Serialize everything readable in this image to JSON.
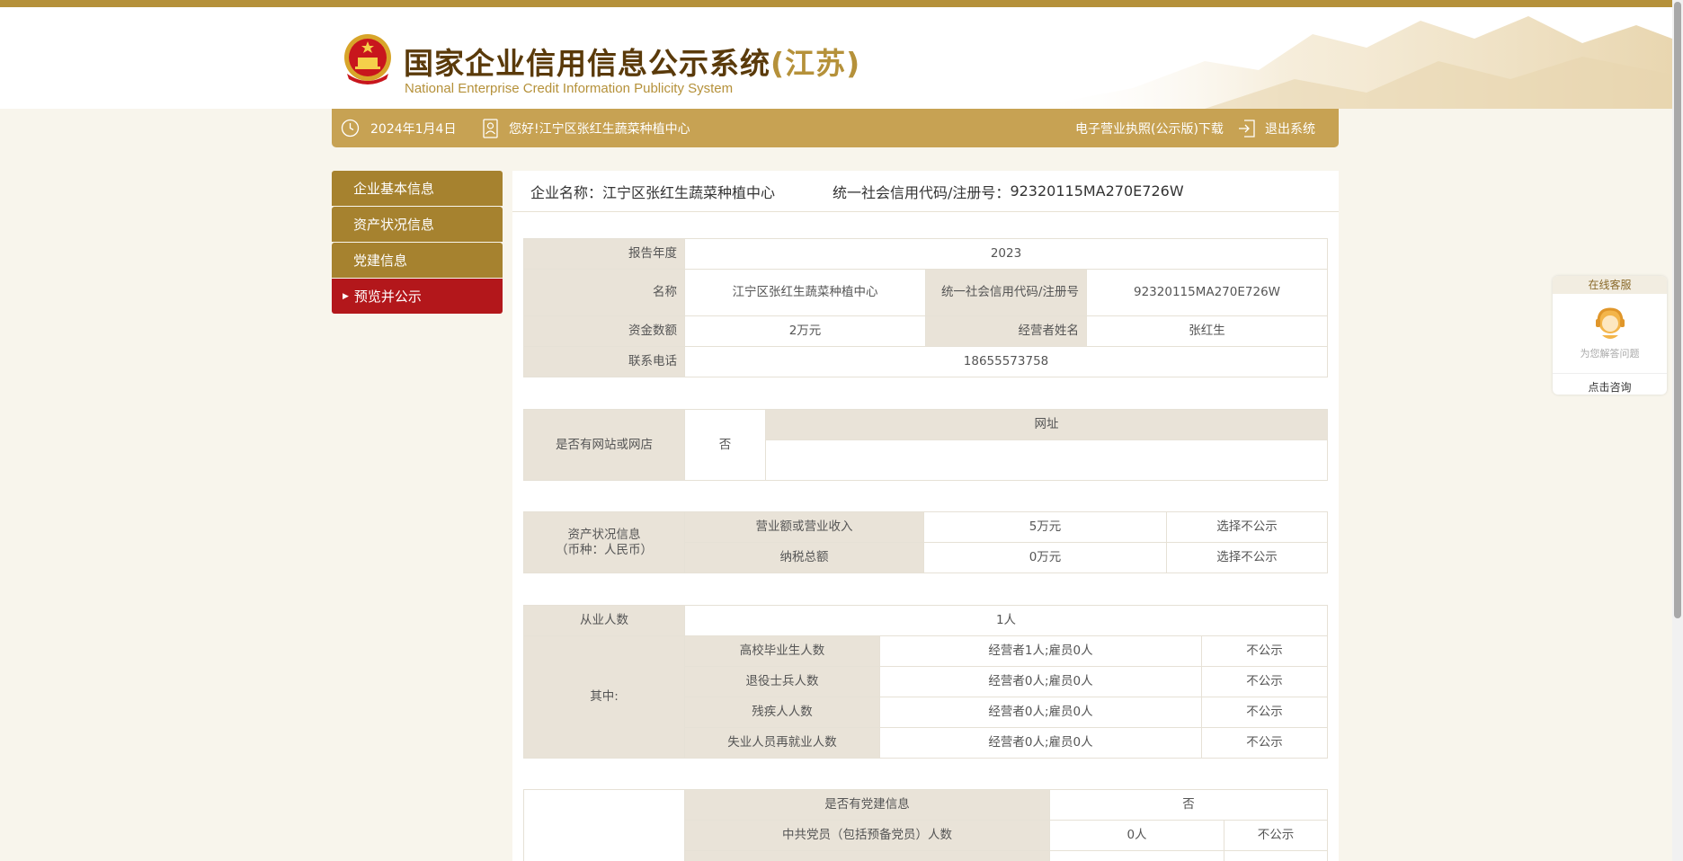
{
  "header": {
    "title_main": "国家企业信用信息公示系统",
    "title_prov": "(江苏)",
    "title_en": "National Enterprise Credit Information Publicity System"
  },
  "topbar": {
    "date": "2024年1月4日",
    "greeting": "您好!江宁区张红生蔬菜种植中心",
    "download_label": "电子营业执照(公示版)下载",
    "logout_label": "退出系统"
  },
  "sidebar": {
    "items": [
      {
        "label": "企业基本信息"
      },
      {
        "label": "资产状况信息"
      },
      {
        "label": "党建信息"
      },
      {
        "label": "预览并公示"
      }
    ]
  },
  "enterprise": {
    "name_label": "企业名称：",
    "name": "江宁区张红生蔬菜种植中心",
    "code_label": "统一社会信用代码/注册号：",
    "code": "92320115MA270E726W"
  },
  "basic": {
    "year_label": "报告年度",
    "year": "2023",
    "name_label": "名称",
    "name": "江宁区张红生蔬菜种植中心",
    "code_label": "统一社会信用代码/注册号",
    "code": "92320115MA270E726W",
    "capital_label": "资金数额",
    "capital": "2万元",
    "operator_label": "经营者姓名",
    "operator": "张红生",
    "phone_label": "联系电话",
    "phone": "18655573758"
  },
  "website": {
    "has_label": "是否有网站或网店",
    "has_value": "否",
    "url_label": "网址",
    "url_value": ""
  },
  "assets": {
    "label_line1": "资产状况信息",
    "label_line2": "（币种：人民币）",
    "rows": [
      {
        "name": "营业额或营业收入",
        "value": "5万元",
        "status": "选择不公示"
      },
      {
        "name": "纳税总额",
        "value": "0万元",
        "status": "选择不公示"
      }
    ]
  },
  "employees": {
    "total_label": "从业人数",
    "total": "1人",
    "among_label": "其中:",
    "rows": [
      {
        "name": "高校毕业生人数",
        "value": "经营者1人;雇员0人",
        "status": "不公示"
      },
      {
        "name": "退役士兵人数",
        "value": "经营者0人;雇员0人",
        "status": "不公示"
      },
      {
        "name": "残疾人人数",
        "value": "经营者0人;雇员0人",
        "status": "不公示"
      },
      {
        "name": "失业人员再就业人数",
        "value": "经营者0人;雇员0人",
        "status": "不公示"
      }
    ]
  },
  "party": {
    "has_label": "是否有党建信息",
    "has_value": "否",
    "members_label": "中共党员（包括预备党员）人数",
    "members_value": "0人",
    "members_status": "不公示"
  },
  "customer_service": {
    "title": "在线客服",
    "subtitle": "为您解答问题",
    "button": "点击咨询"
  },
  "colors": {
    "brand_gold": "#c7a253",
    "nav_gold": "#a6822f",
    "nav_active_red": "#b3171b",
    "title_brown": "#5a3a0a"
  },
  "icons": [
    "national-emblem-icon",
    "clock-icon",
    "user-icon",
    "logout-icon",
    "customer-service-icon"
  ]
}
